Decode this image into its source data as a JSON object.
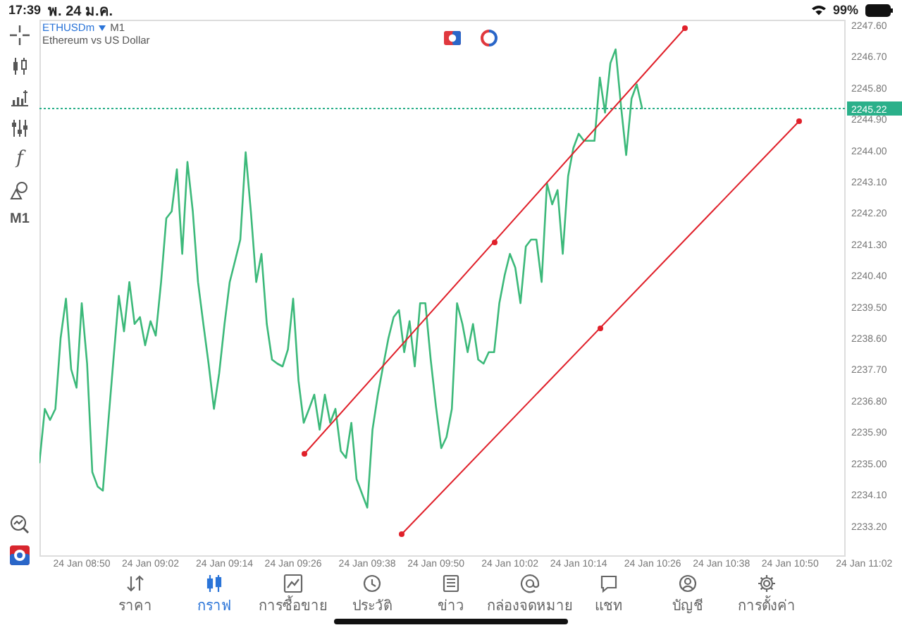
{
  "status_bar": {
    "time": "17:39",
    "date": "พ. 24 ม.ค.",
    "battery": "99%"
  },
  "toolbar": {
    "function_symbol": "f",
    "timeframe": "M1"
  },
  "chart": {
    "symbol": "ETHUSDm",
    "timeframe": "M1",
    "description": "Ethereum vs US Dollar",
    "chart_data": {
      "type": "line",
      "ylim": [
        2232.32,
        2247.76
      ],
      "yticks": [
        {
          "value": 2247.6,
          "label": "2247.60"
        },
        {
          "value": 2246.7,
          "label": "2246.70"
        },
        {
          "value": 2245.8,
          "label": "2245.80"
        },
        {
          "value": 2244.9,
          "label": "2244.90"
        },
        {
          "value": 2244.0,
          "label": "2244.00"
        },
        {
          "value": 2243.1,
          "label": "2243.10"
        },
        {
          "value": 2242.2,
          "label": "2242.20"
        },
        {
          "value": 2241.3,
          "label": "2241.30"
        },
        {
          "value": 2240.4,
          "label": "2240.40"
        },
        {
          "value": 2239.5,
          "label": "2239.50"
        },
        {
          "value": 2238.6,
          "label": "2238.60"
        },
        {
          "value": 2237.7,
          "label": "2237.70"
        },
        {
          "value": 2236.8,
          "label": "2236.80"
        },
        {
          "value": 2235.9,
          "label": "2235.90"
        },
        {
          "value": 2235.0,
          "label": "2235.00"
        },
        {
          "value": 2234.1,
          "label": "2234.10"
        },
        {
          "value": 2233.2,
          "label": "2233.20"
        }
      ],
      "categories": [
        null,
        null,
        null,
        null,
        null,
        null,
        null,
        null,
        "24 Jan 08:50",
        null,
        null,
        null,
        null,
        null,
        null,
        null,
        null,
        null,
        null,
        null,
        null,
        "24 Jan 09:02",
        null,
        null,
        null,
        null,
        null,
        null,
        null,
        null,
        null,
        null,
        null,
        null,
        null,
        "24 Jan 09:14",
        null,
        null,
        null,
        null,
        null,
        null,
        null,
        null,
        null,
        null,
        null,
        null,
        "24 Jan 09:26",
        null,
        null,
        null,
        null,
        null,
        null,
        null,
        null,
        null,
        null,
        null,
        null,
        null,
        "24 Jan 09:38",
        null,
        null,
        null,
        null,
        null,
        null,
        null,
        null,
        null,
        null,
        null,
        null,
        "24 Jan 09:50",
        null,
        null,
        null,
        null,
        null,
        null,
        null,
        null,
        null,
        null,
        null,
        null,
        null,
        "24 Jan 10:02",
        null,
        null,
        null,
        null,
        null,
        null,
        null,
        null,
        null,
        null,
        null,
        null,
        "24 Jan 10:14",
        null,
        null,
        null,
        null,
        null,
        null,
        null,
        null,
        null,
        null,
        null,
        null,
        null,
        "24 Jan 10:26",
        null,
        null,
        null,
        null,
        null,
        null,
        null,
        null,
        null,
        null,
        null,
        null,
        "24 Jan 10:38",
        null,
        null,
        null,
        null,
        null,
        null,
        null,
        null,
        null,
        null,
        null,
        null,
        "24 Jan 10:50",
        null,
        null,
        null,
        null,
        null,
        null,
        null,
        null,
        null,
        null,
        null,
        null,
        null,
        "24 Jan 11:02",
        null
      ],
      "series": [
        {
          "color": "#3cb97a",
          "values": [
            2235.03,
            2236.57,
            2236.25,
            2236.57,
            2238.6,
            2239.74,
            2237.71,
            2237.18,
            2239.61,
            2237.87,
            2234.75,
            2234.34,
            2234.22,
            2236.17,
            2237.99,
            2239.82,
            2238.8,
            2240.22,
            2239.01,
            2239.21,
            2238.4,
            2239.09,
            2238.68,
            2240.22,
            2242.05,
            2242.25,
            2243.46,
            2241.03,
            2243.67,
            2242.25,
            2240.22,
            2239.01,
            2237.87,
            2236.57,
            2237.59,
            2239.01,
            2240.22,
            2240.83,
            2241.44,
            2243.95,
            2242.25,
            2240.22,
            2241.03,
            2239.01,
            2237.99,
            2237.87,
            2237.79,
            2238.28,
            2239.74,
            2237.38,
            2236.17,
            2236.57,
            2236.98,
            2235.97,
            2236.98,
            2236.17,
            2236.57,
            2235.36,
            2235.16,
            2236.17,
            2234.55,
            2234.14,
            2233.73,
            2235.97,
            2236.98,
            2237.79,
            2238.6,
            2239.21,
            2239.41,
            2238.2,
            2239.09,
            2237.79,
            2239.61,
            2239.61,
            2237.99,
            2236.65,
            2235.44,
            2235.76,
            2236.57,
            2239.61,
            2239.01,
            2238.2,
            2239.01,
            2237.99,
            2237.87,
            2238.2,
            2238.2,
            2239.61,
            2240.42,
            2241.03,
            2240.63,
            2239.61,
            2241.24,
            2241.44,
            2241.44,
            2240.22,
            2243.06,
            2242.45,
            2242.86,
            2241.03,
            2243.26,
            2244.07,
            2244.48,
            2244.28,
            2244.28,
            2244.28,
            2246.1,
            2245.09,
            2246.51,
            2246.91,
            2245.29,
            2243.87,
            2245.49,
            2245.9,
            2245.21,
            null,
            null,
            null,
            null,
            null,
            null,
            null,
            null,
            null,
            null,
            null,
            null,
            null,
            null,
            null,
            null,
            null,
            null,
            null,
            null,
            null,
            null,
            null,
            null,
            null,
            null,
            null,
            null,
            null,
            null,
            null,
            null,
            null,
            null,
            null,
            null,
            null,
            null,
            null,
            null,
            null,
            null,
            null
          ]
        }
      ]
    },
    "bid_price": {
      "label": "2245.22"
    }
  },
  "tabs": [
    {
      "label": "ราคา",
      "selected": false
    },
    {
      "label": "กราฟ",
      "selected": true
    },
    {
      "label": "การซื้อขาย",
      "selected": false
    },
    {
      "label": "ประวัติ",
      "selected": false
    },
    {
      "label": "ข่าว",
      "selected": false
    },
    {
      "label": "กล่องจดหมาย",
      "selected": false
    },
    {
      "label": "แชท",
      "selected": false
    },
    {
      "label": "บัญชี",
      "selected": false
    },
    {
      "label": "การตั้งค่า",
      "selected": false
    }
  ]
}
